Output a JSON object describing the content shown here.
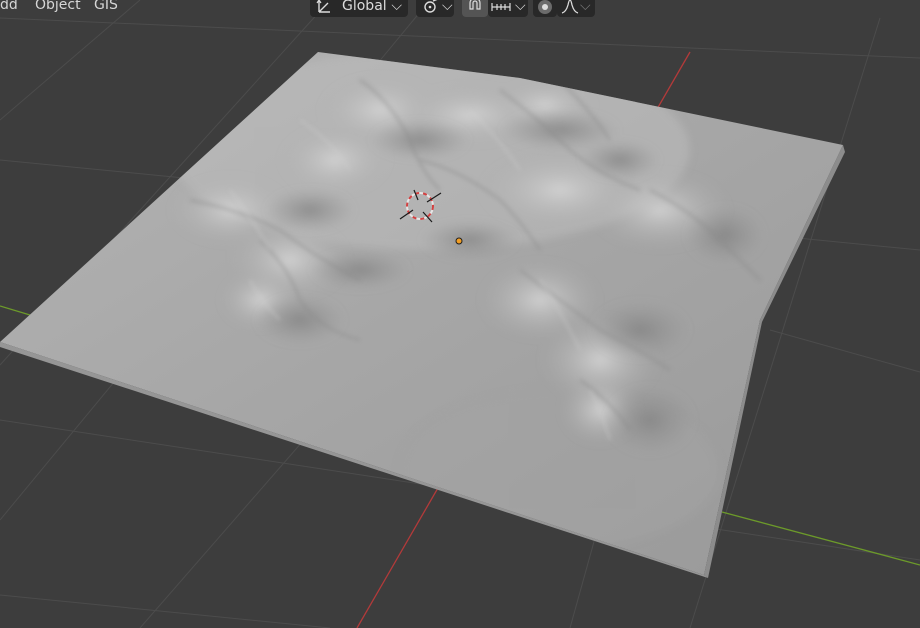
{
  "header": {
    "menu": {
      "add": "dd",
      "object": "Object",
      "gis": "GIS"
    },
    "transform_orientation": {
      "icon": "orientation-icon",
      "value": "Global"
    },
    "pivot_icon": "pivot-link-icon",
    "snap_icon": "snap-magnet-icon",
    "snap_target_icon": "snap-increment-icon",
    "proportional_icon": "proportional-edit-icon",
    "falloff_icon": "falloff-curve-icon"
  },
  "viewport": {
    "object": "terrain-mesh",
    "colors": {
      "background": "#3d3d3d",
      "grid": "#4a4a4a",
      "x_axis": "#b33a3a",
      "y_axis": "#6c9a2a",
      "terrain": "#a7a7a7",
      "origin": "#f29e24"
    }
  }
}
